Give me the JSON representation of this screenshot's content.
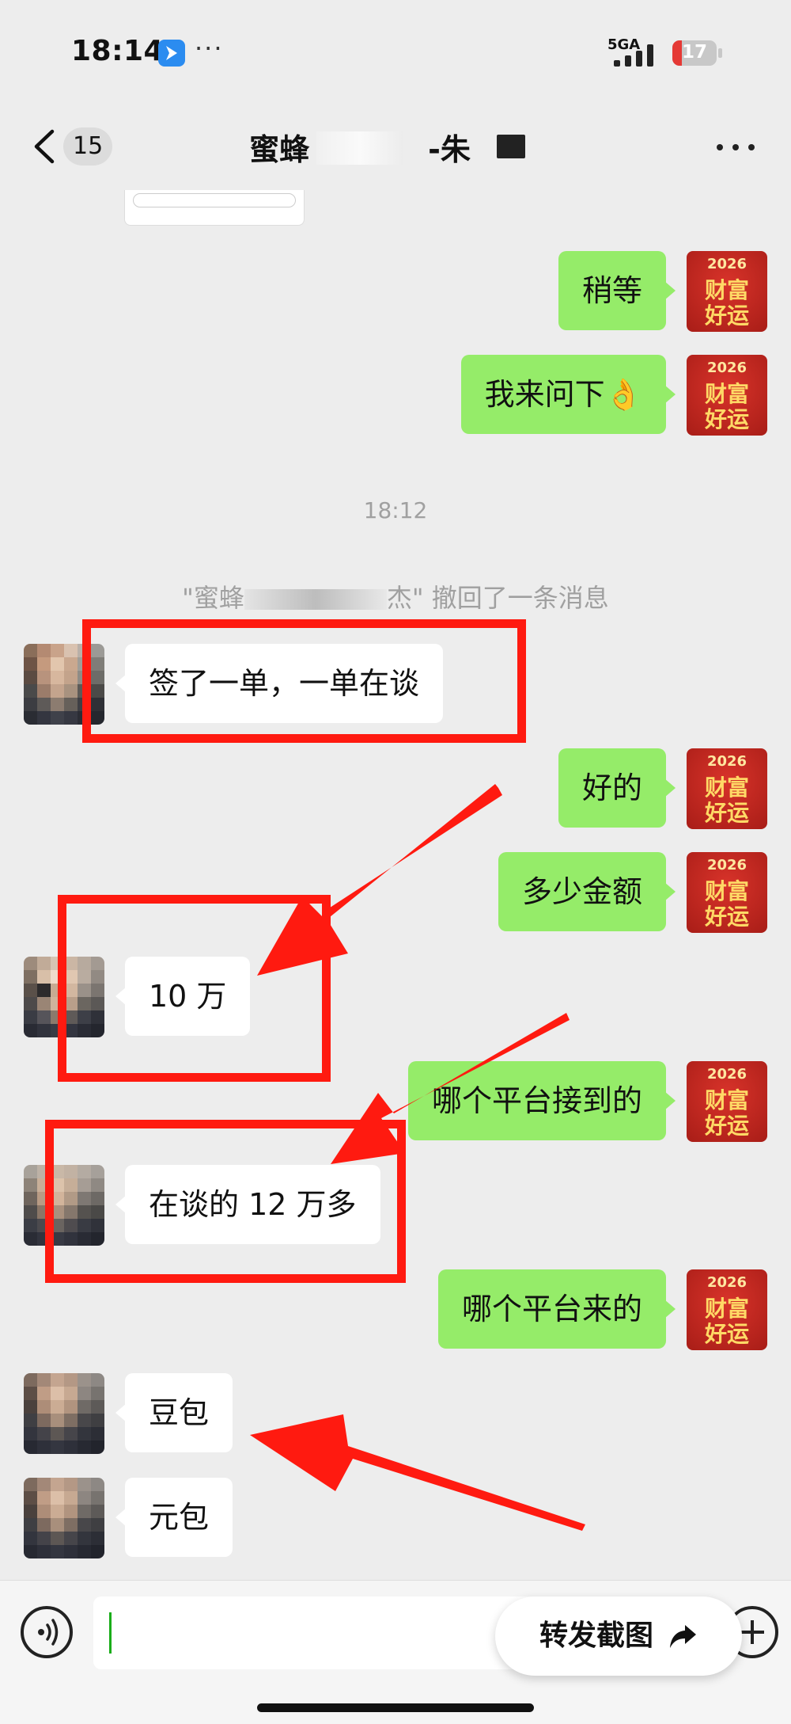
{
  "status_bar": {
    "time": "18:14",
    "app_icon": "airplane-app-icon",
    "dots": "···",
    "network": "5GA",
    "battery": "17",
    "colors": {
      "battery_low": "#e53935",
      "app_icon_bg": "#2b8cf0"
    }
  },
  "nav": {
    "back_icon": "chevron-left-icon",
    "unread_count": "15",
    "title_left": "蜜蜂",
    "title_right": "-朱",
    "more_icon": "more-horizontal-icon"
  },
  "avatar_me": {
    "year": "2026",
    "line1": "财富",
    "line2": "好运"
  },
  "messages": {
    "m1": "稍等",
    "m2": "我来问下👌",
    "time_1812": "18:12",
    "recall_notice": "\"蜜蜂",
    "recall_name_end": "杰\" 撤回了一条消息",
    "m3": "签了一单，一单在谈",
    "m4": "好的",
    "m5": "多少金额",
    "m6": "10 万",
    "m7": "哪个平台接到的",
    "m8": "在谈的 12 万多",
    "m9": "哪个平台来的",
    "m10": "豆包",
    "m11": "元包"
  },
  "input_bar": {
    "voice_icon": "voice-icon",
    "forward_label": "转发截图",
    "forward_icon": "share-arrow-icon",
    "plus_icon": "plus-icon"
  },
  "colors": {
    "background": "#ededed",
    "bubble_out": "#95ec69",
    "bubble_in": "#ffffff",
    "annotation_red": "#ff1a10"
  }
}
